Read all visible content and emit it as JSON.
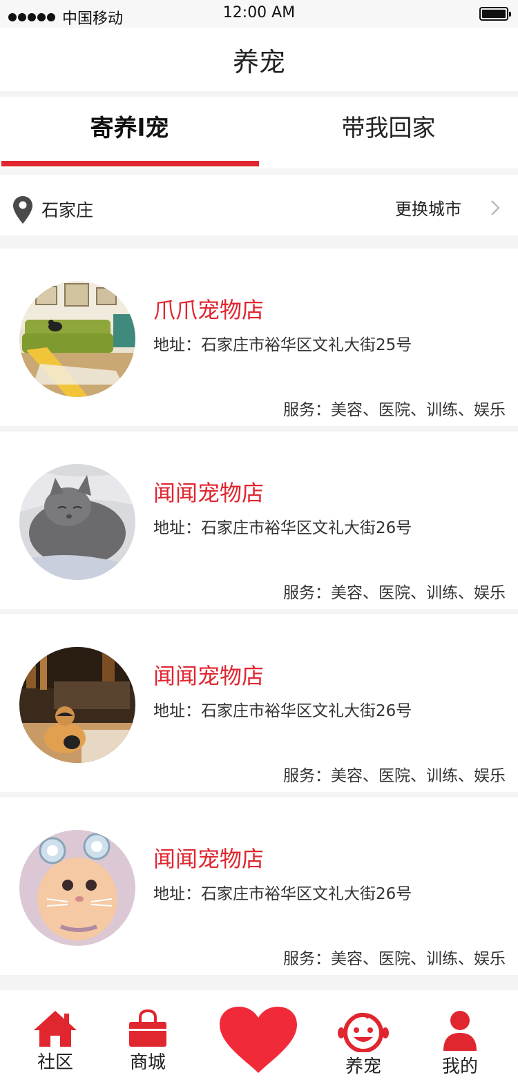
{
  "status_bar": {
    "carrier": "中国移动",
    "time": "12:00 AM"
  },
  "nav": {
    "title": "养宠"
  },
  "tabs": [
    {
      "label": "寄养l宠",
      "active": true
    },
    {
      "label": "带我回家",
      "active": false
    }
  ],
  "location": {
    "city": "石家庄",
    "change_label": "更换城市"
  },
  "stores": [
    {
      "name": "爪爪宠物店",
      "address": "地址：石家庄市裕华区文礼大街25号",
      "services": "服务：美容、医院、训练、娱乐"
    },
    {
      "name": "闻闻宠物店",
      "address": "地址：石家庄市裕华区文礼大街26号",
      "services": "服务：美容、医院、训练、娱乐"
    },
    {
      "name": "闻闻宠物店",
      "address": "地址：石家庄市裕华区文礼大街26号",
      "services": "服务：美容、医院、训练、娱乐"
    },
    {
      "name": "闻闻宠物店",
      "address": "地址：石家庄市裕华区文礼大街26号",
      "services": "服务：美容、医院、训练、娱乐"
    }
  ],
  "tab_bar": {
    "community": "社区",
    "mall": "商城",
    "pets": "养宠",
    "mine": "我的"
  },
  "colors": {
    "accent": "#e0262f",
    "background": "#f4f4f4"
  }
}
